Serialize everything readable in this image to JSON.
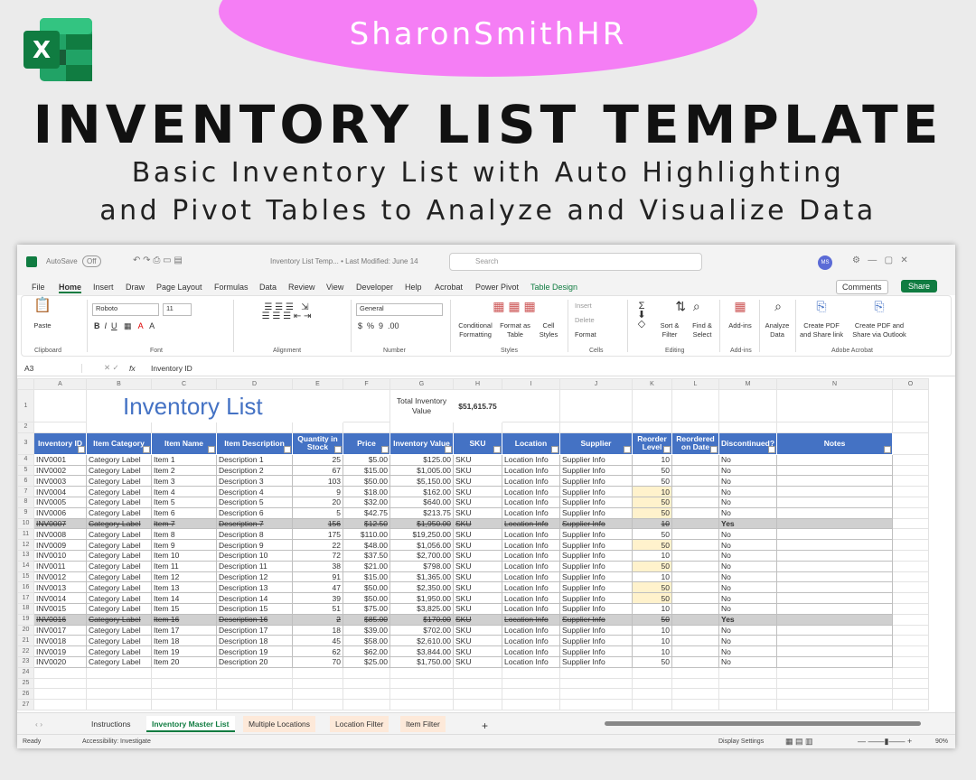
{
  "banner": {
    "brand": "SharonSmithHR",
    "title": "INVENTORY LIST TEMPLATE",
    "subtitle_line1": "Basic Inventory List with Auto Highlighting",
    "subtitle_line2": "and Pivot Tables to Analyze and Visualize Data"
  },
  "titlebar": {
    "autosave": "AutoSave",
    "autosave_state": "Off",
    "doc_title": "Inventory List Temp... • Last Modified: June 14",
    "search_placeholder": "Search",
    "user_initials": "MS"
  },
  "menu": [
    "File",
    "Home",
    "Insert",
    "Draw",
    "Page Layout",
    "Formulas",
    "Data",
    "Review",
    "View",
    "Developer",
    "Help",
    "Acrobat",
    "Power Pivot",
    "Table Design"
  ],
  "menu_right": {
    "comments": "Comments",
    "share": "Share"
  },
  "ribbon": {
    "paste": "Paste",
    "clipboard": "Clipboard",
    "font_name": "Roboto",
    "font_size": "11",
    "font": "Font",
    "alignment": "Alignment",
    "number_format": "General",
    "number": "Number",
    "cond_format": "Conditional Formatting",
    "format_table": "Format as Table",
    "cell_styles": "Cell Styles",
    "styles": "Styles",
    "insert": "Insert",
    "delete": "Delete",
    "format": "Format",
    "cells": "Cells",
    "sort_filter": "Sort & Filter",
    "find_select": "Find & Select",
    "editing": "Editing",
    "addins": "Add-ins",
    "analyze": "Analyze Data",
    "create_pdf_link": "Create PDF and Share link",
    "create_pdf_outlook": "Create PDF and Share via Outlook",
    "adobe": "Adobe Acrobat"
  },
  "formula_bar": {
    "cell_ref": "A3",
    "fx": "fx",
    "content": "Inventory ID"
  },
  "sheet": {
    "columns": [
      "A",
      "B",
      "C",
      "D",
      "E",
      "F",
      "G",
      "H",
      "I",
      "J",
      "K",
      "L",
      "M",
      "N",
      "O"
    ],
    "title": "Inventory List",
    "total_label": "Total Inventory Value",
    "total_value": "$51,615.75",
    "headers": [
      "Inventory ID",
      "Item Category",
      "Item Name",
      "Item Description",
      "Quantity in Stock",
      "Price",
      "Inventory Value",
      "SKU",
      "Location",
      "Supplier",
      "Reorder Level",
      "Reordered on Date",
      "Discontinued?",
      "Notes"
    ],
    "rows": [
      [
        "INV0001",
        "Category Label",
        "Item 1",
        "Description 1",
        "25",
        "$5.00",
        "$125.00",
        "SKU",
        "Location Info",
        "Supplier Info",
        "10",
        "",
        "No"
      ],
      [
        "INV0002",
        "Category Label",
        "Item 2",
        "Description 2",
        "67",
        "$15.00",
        "$1,005.00",
        "SKU",
        "Location Info",
        "Supplier Info",
        "50",
        "",
        "No"
      ],
      [
        "INV0003",
        "Category Label",
        "Item 3",
        "Description 3",
        "103",
        "$50.00",
        "$5,150.00",
        "SKU",
        "Location Info",
        "Supplier Info",
        "50",
        "",
        "No"
      ],
      [
        "INV0004",
        "Category Label",
        "Item 4",
        "Description 4",
        "9",
        "$18.00",
        "$162.00",
        "SKU",
        "Location Info",
        "Supplier Info",
        "10",
        "",
        "No"
      ],
      [
        "INV0005",
        "Category Label",
        "Item 5",
        "Description 5",
        "20",
        "$32.00",
        "$640.00",
        "SKU",
        "Location Info",
        "Supplier Info",
        "50",
        "",
        "No"
      ],
      [
        "INV0006",
        "Category Label",
        "Item 6",
        "Description 6",
        "5",
        "$42.75",
        "$213.75",
        "SKU",
        "Location Info",
        "Supplier Info",
        "50",
        "",
        "No"
      ],
      [
        "INV0007",
        "Category Label",
        "Item 7",
        "Description 7",
        "156",
        "$12.50",
        "$1,950.00",
        "SKU",
        "Location Info",
        "Supplier Info",
        "10",
        "",
        "Yes"
      ],
      [
        "INV0008",
        "Category Label",
        "Item 8",
        "Description 8",
        "175",
        "$110.00",
        "$19,250.00",
        "SKU",
        "Location Info",
        "Supplier Info",
        "50",
        "",
        "No"
      ],
      [
        "INV0009",
        "Category Label",
        "Item 9",
        "Description 9",
        "22",
        "$48.00",
        "$1,056.00",
        "SKU",
        "Location Info",
        "Supplier Info",
        "50",
        "",
        "No"
      ],
      [
        "INV0010",
        "Category Label",
        "Item 10",
        "Description 10",
        "72",
        "$37.50",
        "$2,700.00",
        "SKU",
        "Location Info",
        "Supplier Info",
        "10",
        "",
        "No"
      ],
      [
        "INV0011",
        "Category Label",
        "Item 11",
        "Description 11",
        "38",
        "$21.00",
        "$798.00",
        "SKU",
        "Location Info",
        "Supplier Info",
        "50",
        "",
        "No"
      ],
      [
        "INV0012",
        "Category Label",
        "Item 12",
        "Description 12",
        "91",
        "$15.00",
        "$1,365.00",
        "SKU",
        "Location Info",
        "Supplier Info",
        "10",
        "",
        "No"
      ],
      [
        "INV0013",
        "Category Label",
        "Item 13",
        "Description 13",
        "47",
        "$50.00",
        "$2,350.00",
        "SKU",
        "Location Info",
        "Supplier Info",
        "50",
        "",
        "No"
      ],
      [
        "INV0014",
        "Category Label",
        "Item 14",
        "Description 14",
        "39",
        "$50.00",
        "$1,950.00",
        "SKU",
        "Location Info",
        "Supplier Info",
        "50",
        "",
        "No"
      ],
      [
        "INV0015",
        "Category Label",
        "Item 15",
        "Description 15",
        "51",
        "$75.00",
        "$3,825.00",
        "SKU",
        "Location Info",
        "Supplier Info",
        "10",
        "",
        "No"
      ],
      [
        "INV0016",
        "Category Label",
        "Item 16",
        "Description 16",
        "2",
        "$85.00",
        "$170.00",
        "SKU",
        "Location Info",
        "Supplier Info",
        "50",
        "",
        "Yes"
      ],
      [
        "INV0017",
        "Category Label",
        "Item 17",
        "Description 17",
        "18",
        "$39.00",
        "$702.00",
        "SKU",
        "Location Info",
        "Supplier Info",
        "10",
        "",
        "No"
      ],
      [
        "INV0018",
        "Category Label",
        "Item 18",
        "Description 18",
        "45",
        "$58.00",
        "$2,610.00",
        "SKU",
        "Location Info",
        "Supplier Info",
        "10",
        "",
        "No"
      ],
      [
        "INV0019",
        "Category Label",
        "Item 19",
        "Description 19",
        "62",
        "$62.00",
        "$3,844.00",
        "SKU",
        "Location Info",
        "Supplier Info",
        "10",
        "",
        "No"
      ],
      [
        "INV0020",
        "Category Label",
        "Item 20",
        "Description 20",
        "70",
        "$25.00",
        "$1,750.00",
        "SKU",
        "Location Info",
        "Supplier Info",
        "50",
        "",
        "No"
      ]
    ],
    "highlight_rows": [
      4,
      5,
      6,
      9,
      11,
      13,
      14,
      16
    ],
    "discontinued_rows": [
      7,
      16
    ]
  },
  "tabs": [
    "Instructions",
    "Inventory Master List",
    "Multiple Locations",
    "Location Filter",
    "Item Filter"
  ],
  "status": {
    "ready": "Ready",
    "accessibility": "Accessibility: Investigate",
    "display": "Display Settings",
    "zoom": "90%"
  },
  "colors": {
    "accent": "#4472c4",
    "excel_green": "#107c41",
    "banner_pink": "#f57ef5",
    "highlight": "#fff2cc"
  }
}
